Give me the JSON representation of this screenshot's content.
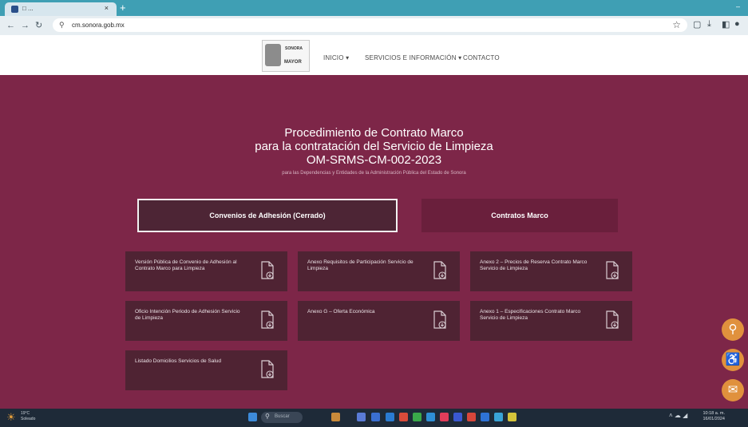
{
  "browser": {
    "tab_title": "□ ...",
    "url": "cm.sonora.gob.mx",
    "new_tab": "+",
    "window_controls": "–"
  },
  "site": {
    "logo_top": "SONORA",
    "logo_bottom": "MAYOR",
    "nav": {
      "inicio": "INICIO",
      "servicios": "SERVICIOS E INFORMACIÓN",
      "contacto": "CONTACTO"
    }
  },
  "hero": {
    "title_line1": "Procedimiento de Contrato Marco",
    "title_line2": "para la contratación del Servicio de Limpieza",
    "title_line3": "OM-SRMS-CM-002-2023",
    "subtitle": "para las Dependencias y Entidades de la Administración Pública del Estado de Sonora"
  },
  "tabs": {
    "convenios": "Convenios de Adhesión (Cerrado)",
    "contratos": "Contratos Marco"
  },
  "documents": [
    {
      "label": "Versión Pública de Convenio de Adhesión al Contrato Marco para Limpieza"
    },
    {
      "label": "Anexo Requisitos de Participación Servicio de Limpieza"
    },
    {
      "label": "Anexo 2 – Precios de Reserva Contrato Marco Servicio de Limpieza"
    },
    {
      "label": "Oficio Intención Periodo de Adhesión Servicio de Limpieza"
    },
    {
      "label": "Anexo G – Oferta Económica"
    },
    {
      "label": "Anexo 1 – Especificaciones Contrato Marco Servicio de Limpieza"
    },
    {
      "label": "Listado Domicilios Servicios de Salud"
    }
  ],
  "taskbar": {
    "weather_temp": "19°C",
    "weather_desc": "Soleado",
    "search": "Buscar",
    "time": "10:18 a. m.",
    "date": "16/01/2024"
  },
  "colors": {
    "maroon": "#7d2648",
    "card": "#4f2333",
    "accent_orange": "#e0913d"
  }
}
